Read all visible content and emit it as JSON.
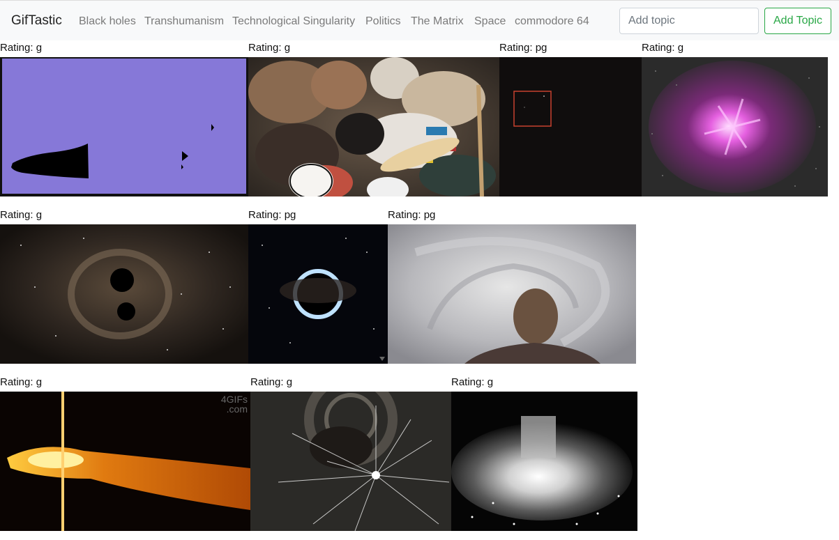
{
  "navbar": {
    "brand": "GifTastic",
    "topics": [
      "Black holes",
      "Transhumanism",
      "Technological Singularity",
      "Politics",
      "The Matrix",
      "Space",
      "commodore 64"
    ],
    "input_placeholder": "Add topic",
    "add_button": "Add Topic"
  },
  "gifs": [
    {
      "rating": "Rating: g"
    },
    {
      "rating": "Rating: g"
    },
    {
      "rating": "Rating: pg"
    },
    {
      "rating": "Rating: g"
    },
    {
      "rating": "Rating: g"
    },
    {
      "rating": "Rating: pg"
    },
    {
      "rating": "Rating: pg"
    },
    {
      "rating": "Rating: g"
    },
    {
      "rating": "Rating: g"
    },
    {
      "rating": "Rating: g"
    }
  ],
  "watermark": "4GIFs\n.com",
  "colors": {
    "accent": "#28a745",
    "nav_bg": "#f8f9fa",
    "link": "#7a7a7a"
  }
}
